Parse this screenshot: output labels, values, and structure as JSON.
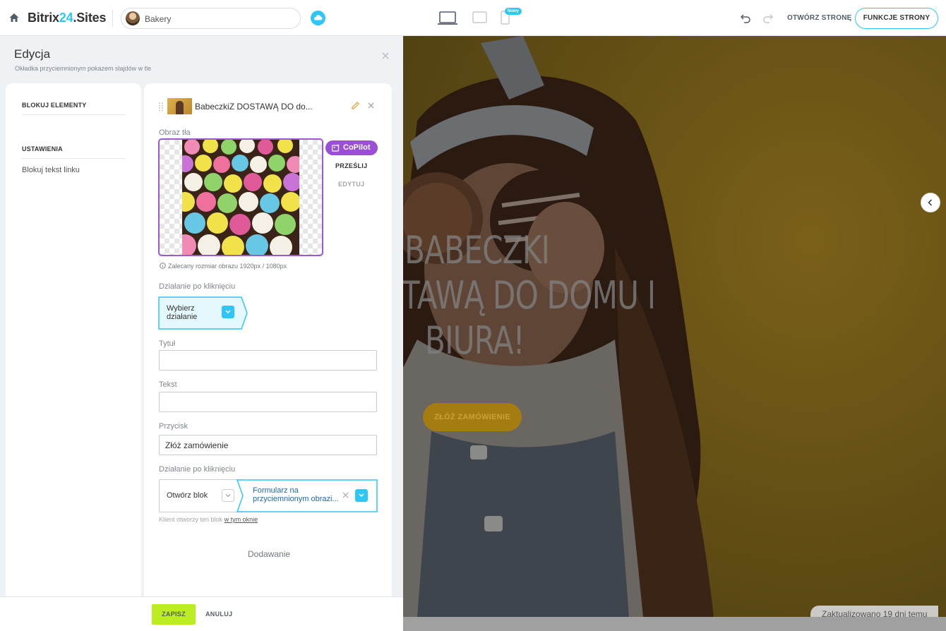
{
  "topbar": {
    "logo_prefix": "Bitrix",
    "logo_number": "24",
    "logo_suffix": ".Sites",
    "site_name": "Bakery",
    "new_badge": "Nowy",
    "open_page": "OTWÓRZ STRONĘ",
    "page_features": "FUNKCJE STRONY",
    "accent": "#2fc6f6"
  },
  "editor": {
    "title": "Edycja",
    "subtitle": "Okładka przyciemnionym pokazem slajdów w tle",
    "nav": {
      "block_elements": "BLOKUJ ELEMENTY",
      "settings": "USTAWIENIA",
      "link_text": "Blokuj tekst linku"
    },
    "card": {
      "block_title": "BabeczkiZ DOSTAWĄ DO do...",
      "bg_label": "Obraz tła",
      "copilot": "CoPilot",
      "upload": "PRZEŚLIJ",
      "edit": "EDYTUJ",
      "hint": "Zalecany rozmiar obrazu 1920px / 1080px",
      "click_action_label": "Działanie po kliknięciu",
      "click_action_value": "Wybierz działanie",
      "title_label": "Tytuł",
      "title_value": "",
      "text_label": "Tekst",
      "text_value": "",
      "button_label": "Przycisk",
      "button_value": "Złóż zamówienie",
      "click_action2_label": "Działanie po kliknięciu",
      "open_block": "Otwórz blok",
      "form_value": "Formularz na przyciemnionym obrazi...",
      "client_note": "Klient otworzy ten blok",
      "client_note_link": "w tym oknie",
      "add": "Dodawanie"
    },
    "footer": {
      "save": "ZAPISZ",
      "cancel": "ANULUJ",
      "save_color": "#bbed21"
    }
  },
  "preview": {
    "hero_line1": "BABECZKI",
    "hero_line2": "TAWĄ DO DOMU I",
    "hero_line3": "BIURA!",
    "hero_button": "ZŁÓŻ ZAMÓWIENIE",
    "updated": "Zaktualizowano 19 dni temu"
  }
}
